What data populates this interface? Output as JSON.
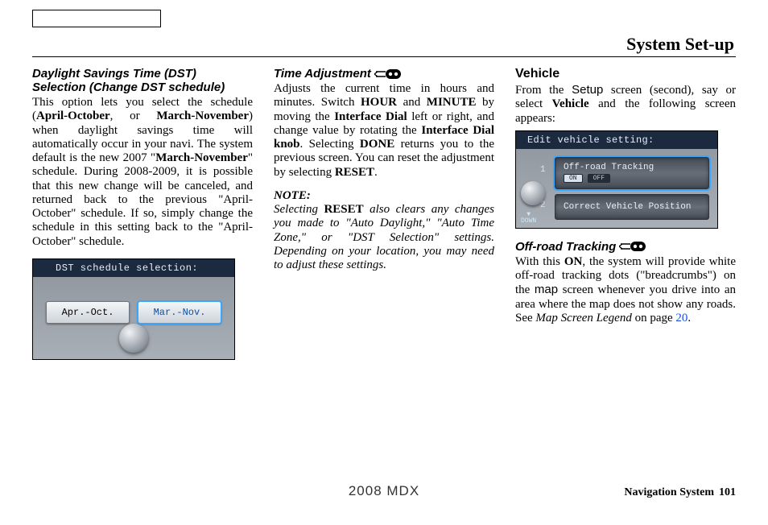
{
  "header": {
    "title": "System Set-up"
  },
  "col1": {
    "heading": "Daylight Savings Time (DST) Selection (Change DST schedule)",
    "p1a": "This option lets you select the schedule (",
    "p1b": "April-October",
    "p1c": ", or ",
    "p1d": "March-November",
    "p1e": ") when daylight savings time will automatically occur in your navi. The system default is the new 2007 \"",
    "p1f": "March-November",
    "p1g": "\" schedule. During 2008-2009, it is possible that this new change will be canceled, and returned back to the previous \"April-October\" schedule. If so, simply change the schedule in this setting back to the \"April-October\" schedule.",
    "shot": {
      "title": "DST schedule selection:",
      "left": "Apr.-Oct.",
      "right": "Mar.-Nov."
    }
  },
  "col2": {
    "heading": "Time Adjustment",
    "p1a": "Adjusts the current time in hours and minutes. Switch ",
    "p1b": "HOUR",
    "p1c": " and ",
    "p1d": "MINUTE",
    "p1e": " by moving the ",
    "p1f": "Interface Dial",
    "p1g": " left or right, and change value by rotating the ",
    "p1h": "Interface Dial knob",
    "p1i": ". Selecting ",
    "p1j": "DONE",
    "p1k": " returns you to the previous screen. You can reset the adjustment by selecting ",
    "p1l": "RESET",
    "p1m": ".",
    "noteLabel": "NOTE:",
    "note_a": "Selecting ",
    "note_b": "RESET",
    "note_c": " also clears any changes you made to \"Auto Daylight,\" \"Auto Time Zone,\" or \"DST Selection\" settings. Depending on your location, you may need to adjust these settings."
  },
  "col3": {
    "heading": "Vehicle",
    "p1a": "From the ",
    "p1b": "Setup",
    "p1c": " screen (second), say or select ",
    "p1d": "Vehicle",
    "p1e": " and the following screen appears:",
    "shot": {
      "title": "Edit vehicle setting:",
      "item1": "Off-road Tracking",
      "on": "ON",
      "off": "OFF",
      "item2": "Correct Vehicle Position",
      "n1": "1",
      "n2": "2",
      "down": "DOWN",
      "arrow": "▼"
    },
    "sub_heading": "Off-road Tracking",
    "p2a": "With this ",
    "p2b": "ON",
    "p2c": ", the system will provide white off-road tracking dots (\"breadcrumbs\") on the ",
    "p2d": "map",
    "p2e": " screen whenever you drive into an area where the map does not show any roads. See ",
    "p2f": "Map Screen Legend",
    "p2g": " on page ",
    "p2h": "20",
    "p2i": "."
  },
  "footer": {
    "center": "2008  MDX",
    "rightLabel": "Navigation System",
    "page": "101"
  }
}
